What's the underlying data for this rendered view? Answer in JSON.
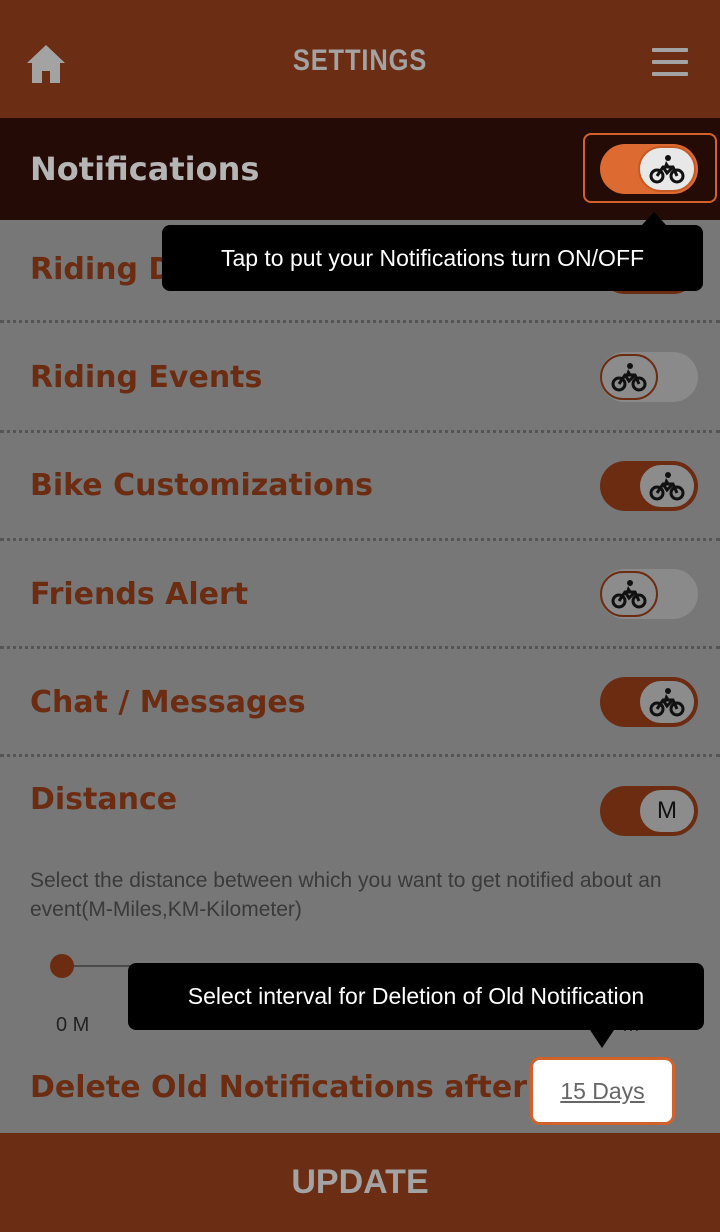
{
  "header": {
    "title": "SETTINGS"
  },
  "notifications": {
    "label": "Notifications",
    "enabled": true
  },
  "tooltips": {
    "toggle": "Tap to put your Notifications turn ON/OFF",
    "delete_interval": "Select interval for Deletion of Old Notification"
  },
  "rows": [
    {
      "label": "Riding De",
      "enabled": true
    },
    {
      "label": "Riding Events",
      "enabled": false
    },
    {
      "label": "Bike Customizations",
      "enabled": true
    },
    {
      "label": "Friends Alert",
      "enabled": false
    },
    {
      "label": "Chat / Messages",
      "enabled": true
    }
  ],
  "distance": {
    "label": "Distance",
    "unit_toggle": "M",
    "description": "Select the distance between which you want to get notified about an event(M-Miles,KM-Kilometer)",
    "slider_min": "0 M",
    "slider_max_partial": "0 M",
    "slider_value_fraction": 0
  },
  "delete_old": {
    "label": "Delete Old Notifications after",
    "value": "15 Days"
  },
  "footer": {
    "update_label": "UPDATE"
  },
  "colors": {
    "header": "#6b2e14",
    "accent": "#dd6a30",
    "label": "#6b2c12",
    "overlay": "#777777"
  },
  "icons": [
    "home-icon",
    "menu-icon",
    "motorbike-icon"
  ]
}
